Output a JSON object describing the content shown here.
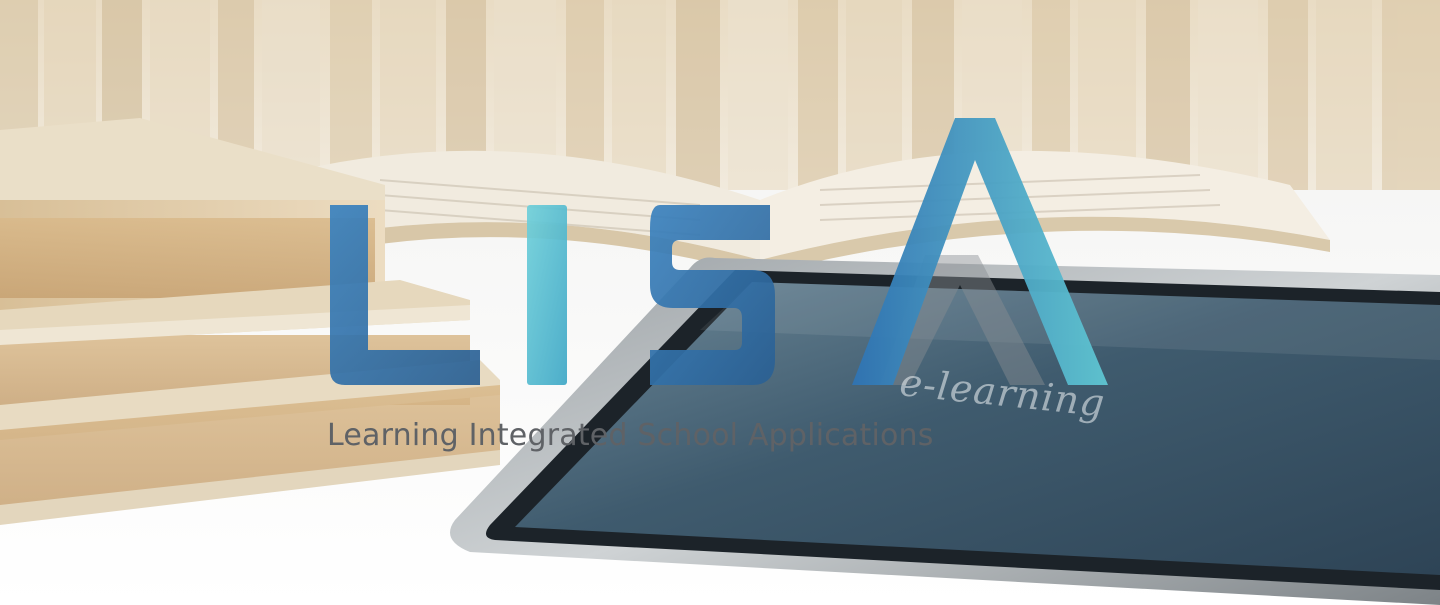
{
  "logo": {
    "letters": [
      "L",
      "I",
      "S",
      "A"
    ],
    "word": "LISA",
    "tagline": "Learning Integrated School Applications",
    "colors": {
      "dark_blue": "#2e6fa6",
      "teal": "#5cc3cf",
      "gray_shadow": "#8a8f93"
    }
  },
  "scene": {
    "handwriting": "e-learning",
    "description_elements": [
      "bookshelf-background",
      "book-stack",
      "open-book",
      "tablet-chalkboard"
    ]
  }
}
